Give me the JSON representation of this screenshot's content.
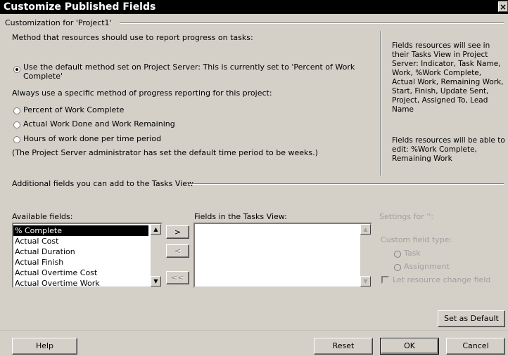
{
  "window": {
    "title": "Customize Published Fields",
    "close_glyph": "×"
  },
  "customization_label": "Customization for 'Project1'",
  "method_prompt": "Method that resources should use to report progress on tasks:",
  "radio_default": {
    "label_line1": "Use the default method set on Project Server: This is currently set to 'Percent of Work",
    "label_line2": "Complete'",
    "checked": true
  },
  "specific_prompt": "Always use a specific method of progress reporting for this project:",
  "radio_percent": {
    "label": "Percent of Work Complete",
    "checked": false
  },
  "radio_actual": {
    "label": "Actual Work Done and Work Remaining",
    "checked": false
  },
  "radio_hours": {
    "label": "Hours of work done per time period",
    "checked": false
  },
  "admin_note": "(The Project Server administrator has set the default time period to be weeks.)",
  "side_info": {
    "see_text": "Fields resources will see in their Tasks View in Project Server: Indicator, Task Name, Work, %Work Complete, Actual Work, Remaining Work, Start, Finish, Update Sent, Project, Assigned To, Lead Name",
    "edit_text": "Fields resources will be able to edit: %Work Complete, Remaining Work"
  },
  "additional_label": "Additional fields you can add to the Tasks View",
  "available": {
    "label": "Available fields:",
    "items": [
      "% Complete",
      "Actual Cost",
      "Actual Duration",
      "Actual Finish",
      "Actual Overtime Cost",
      "Actual Overtime Work"
    ],
    "selected_index": 0
  },
  "move_buttons": {
    "add": ">",
    "remove": "<",
    "remove_all": "<<"
  },
  "in_view": {
    "label": "Fields in the Tasks View:",
    "items": []
  },
  "settings": {
    "title": "Settings for '':",
    "custom_type_label": "Custom field type:",
    "task_label": "Task",
    "assignment_label": "Assignment",
    "let_change_label": "Let resource change field"
  },
  "set_default_button": "Set as Default",
  "footer": {
    "help": "Help",
    "reset": "Reset",
    "ok": "OK",
    "cancel": "Cancel"
  }
}
